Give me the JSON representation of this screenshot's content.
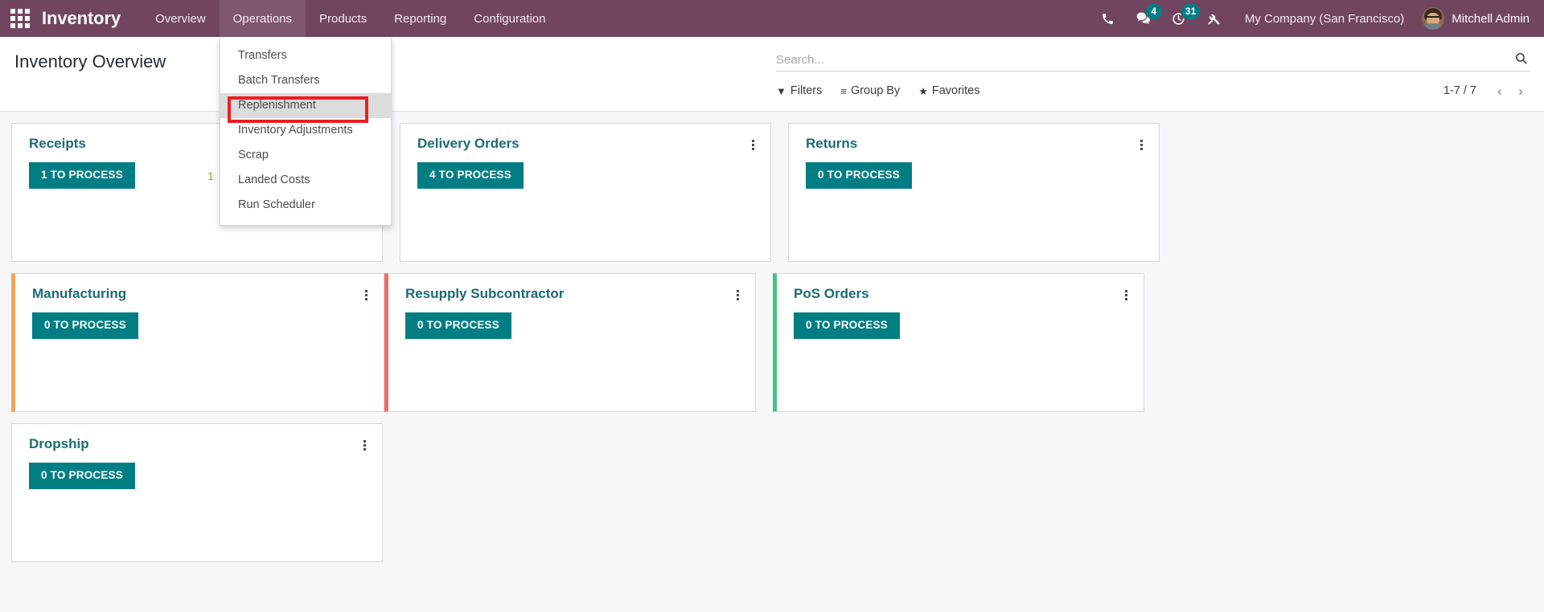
{
  "navbar": {
    "apps_icon": "apps-grid-icon",
    "brand": "Inventory",
    "menus": [
      {
        "label": "Overview",
        "open": false
      },
      {
        "label": "Operations",
        "open": true
      },
      {
        "label": "Products",
        "open": false
      },
      {
        "label": "Reporting",
        "open": false
      },
      {
        "label": "Configuration",
        "open": false
      }
    ],
    "icons": [
      {
        "name": "phone-icon",
        "badge": null
      },
      {
        "name": "messages-icon",
        "badge": "4"
      },
      {
        "name": "activities-clock-icon",
        "badge": "31"
      },
      {
        "name": "debug-tools-icon",
        "badge": null
      }
    ],
    "company": "My Company (San Francisco)",
    "user": "Mitchell Admin",
    "avatar_name": "user-avatar",
    "bg_color": "#71455f"
  },
  "dropdown": {
    "owner": "Operations",
    "items": [
      {
        "label": "Transfers",
        "active": false
      },
      {
        "label": "Batch Transfers",
        "active": false
      },
      {
        "label": "Replenishment",
        "active": true
      },
      {
        "label": "Inventory Adjustments",
        "active": false
      },
      {
        "label": "Scrap",
        "active": false
      },
      {
        "label": "Landed Costs",
        "active": false
      },
      {
        "label": "Run Scheduler",
        "active": false
      }
    ],
    "highlight_color": "#ee1c21",
    "highlighted_item": "Replenishment"
  },
  "control_panel": {
    "title": "Inventory Overview",
    "search_placeholder": "Search...",
    "search_value": "",
    "search_icon": "magnifier-icon",
    "facets": [
      {
        "label": "Filters",
        "icon": "filter-funnel-icon"
      },
      {
        "label": "Group By",
        "icon": "group-lines-icon"
      },
      {
        "label": "Favorites",
        "icon": "star-icon"
      }
    ],
    "pager": {
      "count": "1-7 / 7",
      "prev_icon": "chevron-left-icon",
      "next_icon": "chevron-right-icon"
    }
  },
  "kanban": {
    "accent_colors": {
      "orange": "#f5a35c",
      "red": "#ee6f6a",
      "green": "#3fc47e"
    },
    "button_color": "#017e84",
    "title_color": "#1c6b73",
    "cards": [
      {
        "title": "Receipts",
        "button": "1 TO PROCESS",
        "accent": null,
        "late": "1",
        "menu_visible": false
      },
      {
        "title": "Delivery Orders",
        "button": "4 TO PROCESS",
        "accent": null,
        "late": null,
        "menu_visible": true
      },
      {
        "title": "Returns",
        "button": "0 TO PROCESS",
        "accent": null,
        "late": null,
        "menu_visible": true
      },
      {
        "title": "Manufacturing",
        "button": "0 TO PROCESS",
        "accent": "#f5a35c",
        "late": null,
        "menu_visible": true
      },
      {
        "title": "Resupply Subcontractor",
        "button": "0 TO PROCESS",
        "accent": "#ee6f6a",
        "late": null,
        "menu_visible": true
      },
      {
        "title": "PoS Orders",
        "button": "0 TO PROCESS",
        "accent": "#3fc47e",
        "late": null,
        "menu_visible": true
      },
      {
        "title": "Dropship",
        "button": "0 TO PROCESS",
        "accent": null,
        "late": null,
        "menu_visible": true
      }
    ]
  }
}
